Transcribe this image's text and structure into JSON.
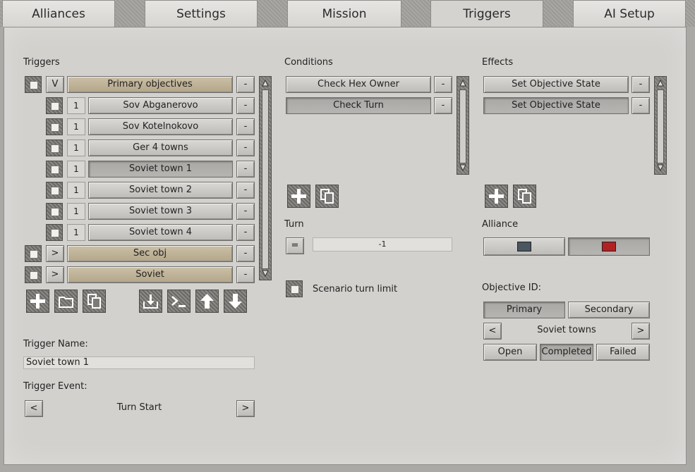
{
  "tabs": [
    "Alliances",
    "Settings",
    "Mission",
    "Triggers",
    "AI Setup"
  ],
  "triggers": {
    "heading": "Triggers",
    "rows": [
      {
        "toggle": "V",
        "label": "Primary objectives",
        "remove": "-",
        "kind": "group"
      },
      {
        "num": "1",
        "label": "Sov Abganerovo",
        "remove": "-",
        "kind": "item"
      },
      {
        "num": "1",
        "label": "Sov Kotelnokovo",
        "remove": "-",
        "kind": "item"
      },
      {
        "num": "1",
        "label": "Ger 4 towns",
        "remove": "-",
        "kind": "item"
      },
      {
        "num": "1",
        "label": "Soviet town 1",
        "remove": "-",
        "kind": "item",
        "selected": true
      },
      {
        "num": "1",
        "label": "Soviet town 2",
        "remove": "-",
        "kind": "item"
      },
      {
        "num": "1",
        "label": "Soviet town 3",
        "remove": "-",
        "kind": "item"
      },
      {
        "num": "1",
        "label": "Soviet town 4",
        "remove": "-",
        "kind": "item"
      },
      {
        "toggle": ">",
        "label": "Sec obj",
        "remove": "-",
        "kind": "group"
      },
      {
        "toggle": ">",
        "label": "Soviet",
        "remove": "-",
        "kind": "group"
      }
    ],
    "toolbar": [
      "add-icon",
      "folder-icon",
      "copy-icon",
      "import-icon",
      "console-icon",
      "arrow-up-icon",
      "arrow-down-icon"
    ]
  },
  "trigger_name": {
    "label": "Trigger Name:",
    "value": "Soviet town 1"
  },
  "trigger_event": {
    "label": "Trigger Event:",
    "prev": "<",
    "value": "Turn Start",
    "next": ">"
  },
  "conditions": {
    "heading": "Conditions",
    "items": [
      {
        "label": "Check Hex Owner",
        "remove": "-"
      },
      {
        "label": "Check Turn",
        "remove": "-",
        "selected": true
      }
    ],
    "turn_label": "Turn",
    "operator": "=",
    "turn_value": "-1",
    "turn_limit_label": "Scenario turn limit"
  },
  "effects": {
    "heading": "Effects",
    "items": [
      {
        "label": "Set Objective State",
        "remove": "-"
      },
      {
        "label": "Set Objective State",
        "remove": "-",
        "selected": true
      }
    ],
    "alliance_label": "Alliance",
    "alliance_colors": [
      "#4a5660",
      "#b22222"
    ],
    "objective_label": "Objective ID:",
    "primary": "Primary",
    "secondary": "Secondary",
    "prev": "<",
    "objective_value": "Soviet towns",
    "next": ">",
    "states": [
      "Open",
      "Completed",
      "Failed"
    ],
    "active_state": "Completed"
  }
}
